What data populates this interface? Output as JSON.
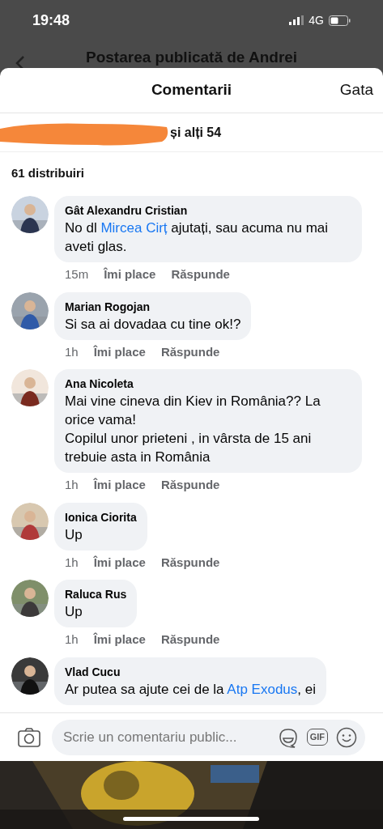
{
  "status_bar": {
    "time": "19:48",
    "network": "4G"
  },
  "behind": {
    "title": "Postarea publicată de Andrei"
  },
  "sheet": {
    "title": "Comentarii",
    "done": "Gata",
    "reactions": "și alți 54",
    "shares": "61 distribuiri"
  },
  "comments": [
    {
      "author": "Gât Alexandru Cristian",
      "body": [
        {
          "text": "No dl ",
          "link": false
        },
        {
          "text": "Mircea Cirț",
          "link": true
        },
        {
          "text": " ajutați, sau acuma nu mai aveti glas.",
          "link": false
        }
      ],
      "time": "15m",
      "like": "Îmi place",
      "reply": "Răspunde"
    },
    {
      "author": "Marian Rogojan",
      "body": [
        {
          "text": "Si sa ai dovadaa cu tine ok!?",
          "link": false
        }
      ],
      "time": "1h",
      "like": "Îmi place",
      "reply": "Răspunde"
    },
    {
      "author": "Ana Nicoleta",
      "body": [
        {
          "text": "Mai vine cineva din Kiev in România?? La orice vama!\nCopilul unor prieteni , in vârsta de 15 ani trebuie asta in România",
          "link": false
        }
      ],
      "time": "1h",
      "like": "Îmi place",
      "reply": "Răspunde"
    },
    {
      "author": "Ionica Ciorita",
      "body": [
        {
          "text": "Up",
          "link": false
        }
      ],
      "time": "1h",
      "like": "Îmi place",
      "reply": "Răspunde"
    },
    {
      "author": "Raluca Rus",
      "body": [
        {
          "text": "Up",
          "link": false
        }
      ],
      "time": "1h",
      "like": "Îmi place",
      "reply": "Răspunde"
    },
    {
      "author": "Vlad Cucu",
      "body": [
        {
          "text": "Ar putea sa ajute cei de la ",
          "link": false
        },
        {
          "text": "Atp Exodus",
          "link": true
        },
        {
          "text": ", ei",
          "link": false
        }
      ]
    }
  ],
  "composer": {
    "placeholder": "Scrie un comentariu public...",
    "gif": "GIF"
  }
}
